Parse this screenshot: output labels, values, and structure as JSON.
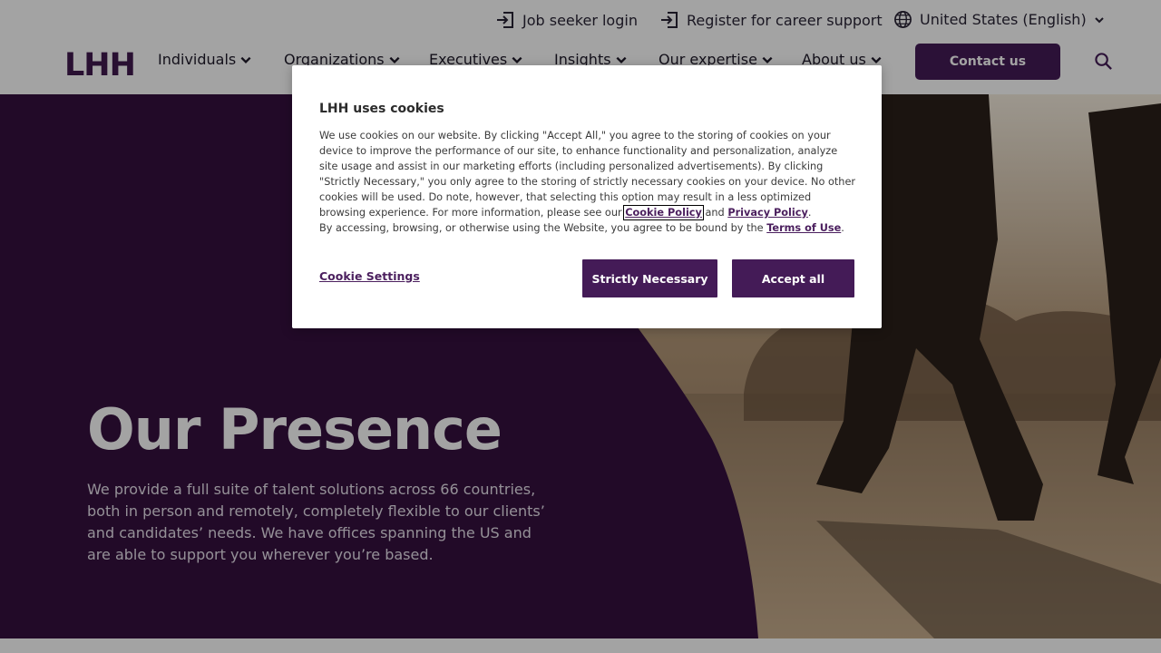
{
  "utility": {
    "job_seeker_login": "Job seeker login",
    "register": "Register for career support",
    "locale": "United States (English)"
  },
  "nav": {
    "logo": "LHH",
    "items": [
      "Individuals",
      "Organizations",
      "Executives",
      "Insights",
      "Our expertise",
      "About us"
    ],
    "contact": "Contact us"
  },
  "hero": {
    "title": "Our Presence",
    "text": "We provide a full suite of talent solutions across 66 countries, both in person and remotely, completely flexible to our clients’ and candidates’ needs. We have offices spanning the US and are able to support you wherever you’re based."
  },
  "cookie": {
    "title": "LHH uses cookies",
    "body_part1": "We use cookies on our website. By clicking \"Accept All,\" you agree to the storing of cookies on your device to improve the performance of our site, to enhance functionality and personalization, analyze site usage and assist in our marketing efforts (including personalized advertisements). By clicking \"Strictly Necessary,\" you only agree to the storing of strictly necessary cookies on your device. No other cookies will be used. Do note, however, that selecting this option may result in a less optimized browsing experience. For more information, please see our ",
    "cookie_policy": "Cookie Policy",
    "and": " and ",
    "privacy_policy": "Privacy Policy",
    "period": ".",
    "body_part2": "By accessing, browsing, or otherwise using the Website, you agree to be bound by the ",
    "terms": "Terms of Use",
    "period2": ".",
    "settings": "Cookie Settings",
    "strictly_necessary": "Strictly Necessary",
    "accept_all": "Accept all"
  },
  "colors": {
    "brand_purple": "#441b57",
    "hero_purple": "#36113f"
  }
}
